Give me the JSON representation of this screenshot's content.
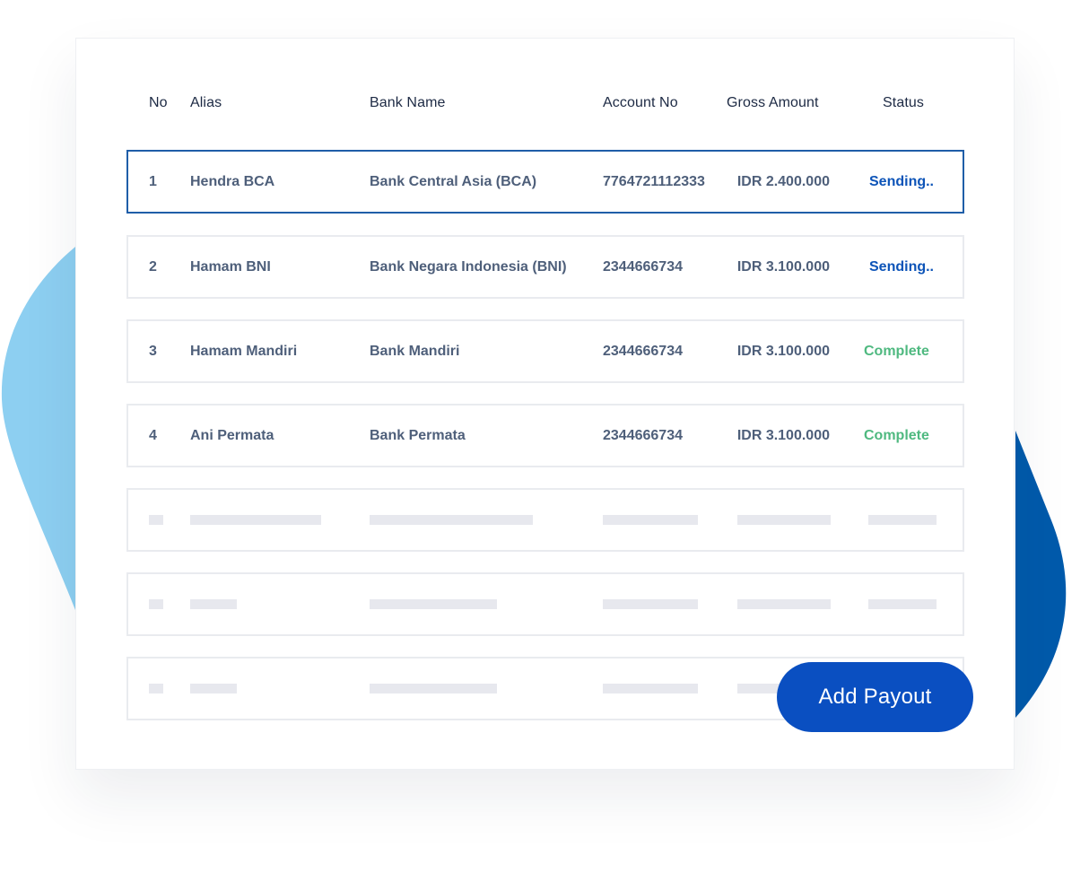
{
  "colors": {
    "accent": "#0a4fc1",
    "sending": "#0d54b8",
    "complete": "#4fb980",
    "blob_light": "#8dcff1",
    "blob_dark": "#005aab"
  },
  "table": {
    "headers": {
      "no": "No",
      "alias": "Alias",
      "bank_name": "Bank Name",
      "account_no": "Account No",
      "gross_amount": "Gross Amount",
      "status": "Status"
    },
    "rows": [
      {
        "no": "1",
        "alias": "Hendra BCA",
        "bank_name": "Bank Central Asia (BCA)",
        "account_no": "7764721112333",
        "gross_amount": "IDR 2.400.000",
        "status": "Sending.."
      },
      {
        "no": "2",
        "alias": "Hamam BNI",
        "bank_name": "Bank Negara Indonesia (BNI)",
        "account_no": "2344666734",
        "gross_amount": "IDR 3.100.000",
        "status": "Sending.."
      },
      {
        "no": "3",
        "alias": "Hamam Mandiri",
        "bank_name": "Bank Mandiri",
        "account_no": "2344666734",
        "gross_amount": "IDR 3.100.000",
        "status": "Complete"
      },
      {
        "no": "4",
        "alias": "Ani Permata",
        "bank_name": "Bank Permata",
        "account_no": "2344666734",
        "gross_amount": "IDR 3.100.000",
        "status": "Complete"
      }
    ]
  },
  "actions": {
    "add_payout_label": "Add Payout"
  }
}
